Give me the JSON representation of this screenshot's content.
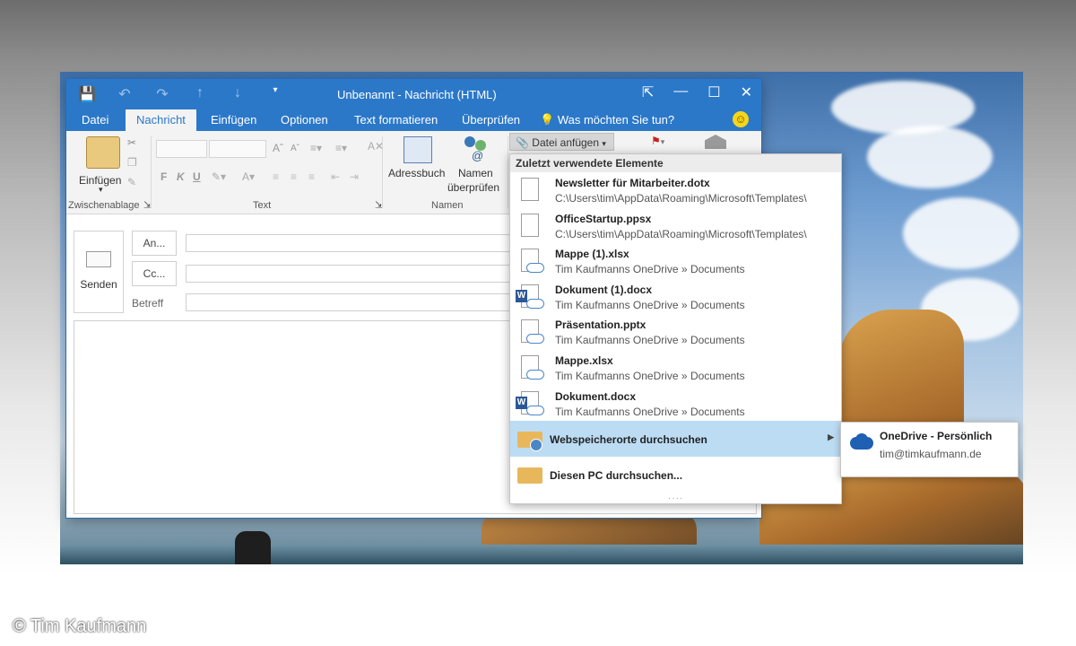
{
  "window": {
    "title": "Unbenannt - Nachricht (HTML)"
  },
  "tabs": [
    "Datei",
    "Nachricht",
    "Einfügen",
    "Optionen",
    "Text formatieren",
    "Überprüfen"
  ],
  "tell_me": "Was möchten Sie tun?",
  "ribbon": {
    "paste_label": "Einfügen",
    "clipboard_group": "Zwischenablage",
    "text_group": "Text",
    "bold": "F",
    "italic": "K",
    "underline": "U",
    "addressbook": "Adressbuch",
    "checknames_line1": "Namen",
    "checknames_line2": "überprüfen",
    "names_group": "Namen",
    "attach_file": "Datei anfügen"
  },
  "compose": {
    "send": "Senden",
    "to": "An...",
    "cc": "Cc...",
    "subject": "Betreff"
  },
  "attach_menu": {
    "header": "Zuletzt verwendete Elemente",
    "items": [
      {
        "name": "Newsletter für Mitarbeiter.dotx",
        "path": "C:\\Users\\tim\\AppData\\Roaming\\Microsoft\\Templates\\",
        "icon": "template-doc-icon"
      },
      {
        "name": "OfficeStartup.ppsx",
        "path": "C:\\Users\\tim\\AppData\\Roaming\\Microsoft\\Templates\\",
        "icon": "generic-doc-icon"
      },
      {
        "name": "Mappe (1).xlsx",
        "path": "Tim Kaufmanns OneDrive » Documents",
        "icon": "cloud-doc-icon"
      },
      {
        "name": "Dokument (1).docx",
        "path": "Tim Kaufmanns OneDrive » Documents",
        "icon": "word-doc-icon"
      },
      {
        "name": "Präsentation.pptx",
        "path": "Tim Kaufmanns OneDrive » Documents",
        "icon": "cloud-doc-icon"
      },
      {
        "name": "Mappe.xlsx",
        "path": "Tim Kaufmanns OneDrive » Documents",
        "icon": "cloud-doc-icon"
      },
      {
        "name": "Dokument.docx",
        "path": "Tim Kaufmanns OneDrive » Documents",
        "icon": "word-doc-icon"
      }
    ],
    "browse_web": "Webspeicherorte durchsuchen",
    "browse_pc": "Diesen PC durchsuchen..."
  },
  "submenu": {
    "title": "OneDrive - Persönlich",
    "email": "tim@timkaufmann.de"
  },
  "copyright": "© Tim Kaufmann",
  "colors": {
    "accent": "#2b78c9",
    "highlight": "#bcdcf4"
  }
}
